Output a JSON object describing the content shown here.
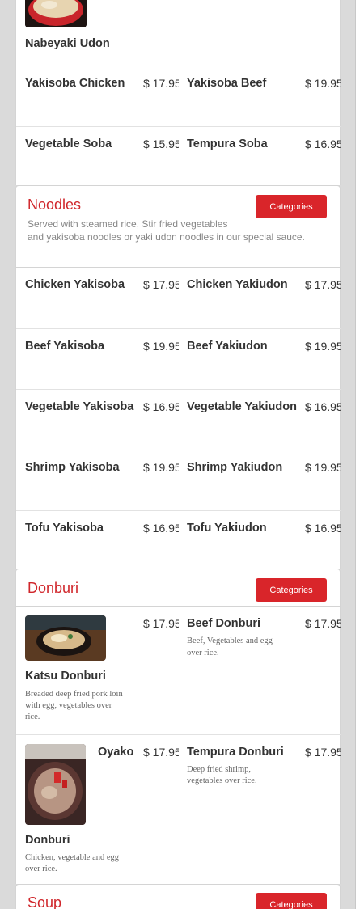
{
  "top_item": {
    "name": "Nabeyaki Udon"
  },
  "top_rows": [
    [
      {
        "name": "Yakisoba Chicken",
        "price": "$ 17.95"
      },
      {
        "name": "Yakisoba Beef",
        "price": "$ 19.95"
      }
    ],
    [
      {
        "name": "Vegetable Soba",
        "price": "$ 15.95"
      },
      {
        "name": "Tempura Soba",
        "price": "$ 16.95"
      }
    ]
  ],
  "noodles": {
    "title": "Noodles",
    "subtitle_line1": "Served with steamed rice, Stir fried vegetables",
    "subtitle_line2": "and yakisoba noodles or yaki udon noodles in our special sauce.",
    "button": "Categories",
    "rows": [
      [
        {
          "name": "Chicken Yakisoba",
          "price": "$ 17.95"
        },
        {
          "name": "Chicken Yakiudon",
          "price": "$ 17.95"
        }
      ],
      [
        {
          "name": "Beef Yakisoba",
          "price": "$ 19.95"
        },
        {
          "name": "Beef Yakiudon",
          "price": "$ 19.95"
        }
      ],
      [
        {
          "name": "Vegetable Yakisoba",
          "price": "$ 16.95"
        },
        {
          "name": "Vegetable Yakiudon",
          "price": "$ 16.95"
        }
      ],
      [
        {
          "name": "Shrimp Yakisoba",
          "price": "$ 19.95"
        },
        {
          "name": "Shrimp Yakiudon",
          "price": "$ 19.95"
        }
      ],
      [
        {
          "name": "Tofu Yakisoba",
          "price": "$ 16.95"
        },
        {
          "name": "Tofu Yakiudon",
          "price": "$ 16.95"
        }
      ]
    ]
  },
  "donburi": {
    "title": "Donburi",
    "button": "Categories",
    "katsu": {
      "name": "Katsu Donburi",
      "price": "$ 17.95",
      "desc_l1": "Breaded deep fried pork loin",
      "desc_l2": "with egg, vegetables over",
      "desc_l3": "rice."
    },
    "beef": {
      "name": "Beef Donburi",
      "price": "$ 17.95",
      "desc_l1": "Beef, Vegetables and egg",
      "desc_l2": "over rice."
    },
    "oyako": {
      "name_part1": "Oyako",
      "name_part2": "Donburi",
      "price": "$ 17.95",
      "desc_l1": "Chicken, vegetable and egg",
      "desc_l2": "over rice."
    },
    "tempura": {
      "name": "Tempura Donburi",
      "price": "$ 17.95",
      "desc_l1": "Deep fried shrimp,",
      "desc_l2": "vegetables over rice."
    }
  },
  "soup": {
    "title": "Soup",
    "button": "Categories"
  },
  "colors": {
    "accent": "#d9252a",
    "title_red": "#d0262b"
  }
}
